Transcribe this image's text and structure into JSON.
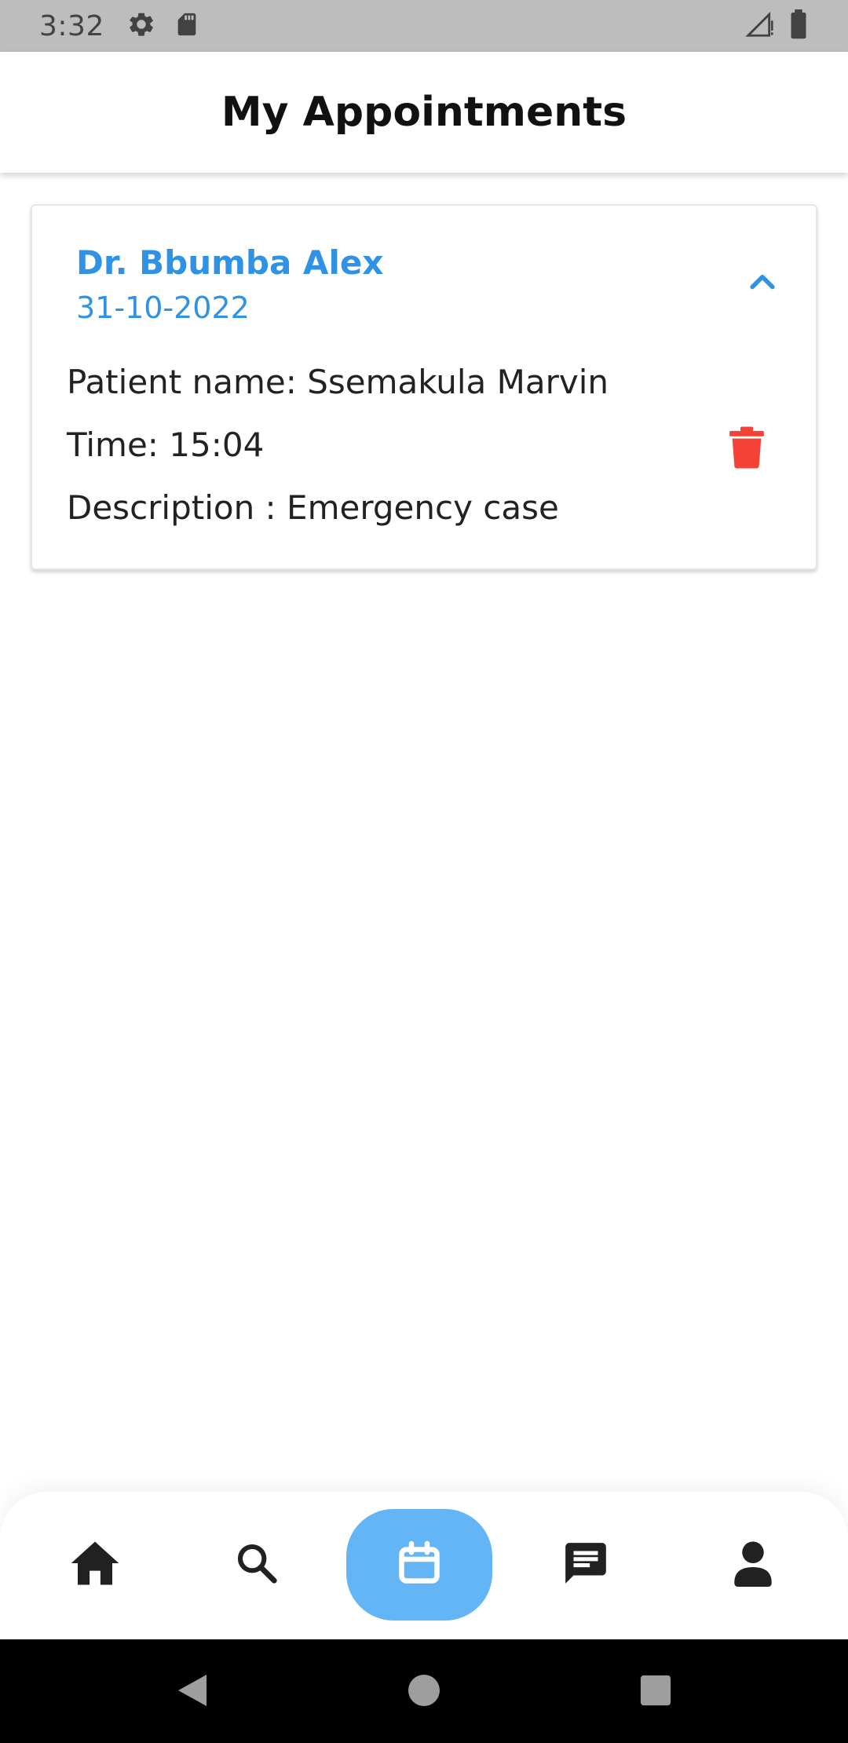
{
  "status_bar": {
    "time": "3:32"
  },
  "header": {
    "title": "My Appointments"
  },
  "appointment": {
    "doctor": "Dr. Bbumba Alex",
    "date": "31-10-2022",
    "patient_line": "Patient name: Ssemakula Marvin",
    "time_line": "Time: 15:04",
    "description_line": "Description : Emergency case"
  },
  "bottom_nav": {
    "items": [
      "home-icon",
      "search-icon",
      "calendar-icon",
      "chat-icon",
      "profile-icon"
    ],
    "active": "calendar-icon"
  },
  "colors": {
    "accent": "#2f92e4",
    "active_nav": "#64b5f6",
    "delete": "#f44336"
  }
}
